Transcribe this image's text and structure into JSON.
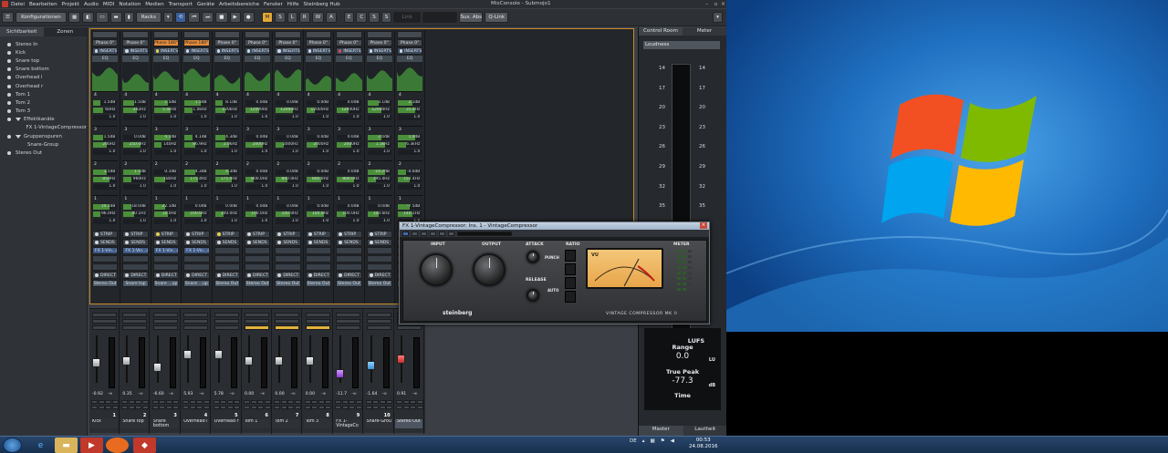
{
  "menubar": {
    "items": [
      "Datei",
      "Bearbeiten",
      "Projekt",
      "Audio",
      "MIDI",
      "Notation",
      "Medien",
      "Transport",
      "Geräte",
      "Arbeitsbereiche",
      "Fenster",
      "Hilfe",
      "Steinberg Hub"
    ],
    "title": "MixConsole - Submojo1"
  },
  "toolbar": {
    "config_label": "Konfigurationen",
    "racks_label": "Racks",
    "m": "M",
    "s": "S",
    "l": "L",
    "r": "R",
    "w": "W",
    "a": "A",
    "e": "E",
    "c": "C",
    "s2": "S",
    "s3": "S",
    "link": "Link",
    "sun_abs": "Sus. Abs",
    "qlink": "Q-Link"
  },
  "leftpanel": {
    "tab_visibility": "Sichtbarkeit",
    "tab_zones": "Zonen",
    "items": [
      {
        "label": "Stereo In",
        "indent": 0,
        "type": "dot"
      },
      {
        "label": "Kick",
        "indent": 0,
        "type": "dot"
      },
      {
        "label": "Snare top",
        "indent": 0,
        "type": "dot"
      },
      {
        "label": "Snare bottom",
        "indent": 0,
        "type": "dot"
      },
      {
        "label": "Overhead l",
        "indent": 0,
        "type": "dot"
      },
      {
        "label": "Overhead r",
        "indent": 0,
        "type": "dot"
      },
      {
        "label": "Tom 1",
        "indent": 0,
        "type": "dot"
      },
      {
        "label": "Tom 2",
        "indent": 0,
        "type": "dot"
      },
      {
        "label": "Tom 3",
        "indent": 0,
        "type": "dot"
      },
      {
        "label": "Effektkanäle",
        "indent": 0,
        "type": "group"
      },
      {
        "label": "FX 1-VintageCompressor",
        "indent": 1,
        "type": "none"
      },
      {
        "label": "Gruppenspuren",
        "indent": 0,
        "type": "group"
      },
      {
        "label": "Snare-Group",
        "indent": 1,
        "type": "none"
      },
      {
        "label": "Stereo Out",
        "indent": 0,
        "type": "dot"
      }
    ]
  },
  "channels": [
    {
      "phase": "Phase 0°",
      "phase_on": false,
      "ins_dot": "w",
      "eq": [
        [
          "1.5dB",
          "60Hz",
          "1.0"
        ],
        [
          "1.5dB",
          "200Hz",
          "1.0"
        ],
        [
          "1.5dB",
          "850Hz",
          "1.0"
        ],
        [
          "10.1dB",
          "96.0Hz",
          "1.0"
        ]
      ],
      "strip_dot": "w",
      "fx": "FX 1-Vin...or",
      "out": "Stereo Out",
      "fader": "-0.92",
      "num": "1",
      "name": "Kick",
      "cap": "white",
      "cap_pos": 0.55
    },
    {
      "phase": "Phase 0°",
      "phase_on": false,
      "ins_dot": "w",
      "eq": [
        [
          "1.5dB",
          "202Hz",
          "1.0"
        ],
        [
          "0.0dB",
          "250.0Hz",
          "1.0"
        ],
        [
          "1.1dB",
          "960Hz",
          "1.0"
        ],
        [
          "-18.0dB",
          "40.1Hz",
          "1.0"
        ]
      ],
      "strip_dot": "w",
      "fx": "FX 1-Vin...or",
      "out": "Snare top",
      "fader": "0.35",
      "num": "2",
      "name": "Snare top",
      "cap": "white",
      "cap_pos": 0.5
    },
    {
      "phase": "Phase 180°",
      "phase_on": true,
      "ins_dot": "y",
      "eq": [
        [
          "1.5dB",
          "5.4kHz",
          "1.0"
        ],
        [
          "4.1dB",
          "140Hz",
          "1.0"
        ],
        [
          "0.1dB",
          "180Hz",
          "1.0"
        ],
        [
          "22.1dB",
          "10.0Hz",
          "1.0"
        ]
      ],
      "strip_dot": "y",
      "fx": "FX 1-Vin...or",
      "out": "Snare ...up",
      "fader": "-6.60",
      "num": "3",
      "name": "Snare bottom",
      "cap": "white",
      "cap_pos": 0.65
    },
    {
      "phase": "Phase 180°",
      "phase_on": true,
      "ins_dot": "w",
      "eq": [
        [
          "1.5dB",
          "1.0kHz",
          "1.0"
        ],
        [
          "4.1dB",
          "86.9Hz",
          "1.0"
        ],
        [
          "4.3dB",
          "175.4Hz",
          "1.0"
        ],
        [
          "0.0dB",
          "100.0Hz",
          "1.0"
        ]
      ],
      "strip_dot": "w",
      "fx": "FX 1-Vin...or",
      "out": "Snare ...up",
      "fader": "5.93",
      "num": "4",
      "name": "Overhead l",
      "cap": "white",
      "cap_pos": 0.35
    },
    {
      "phase": "Phase 0°",
      "phase_on": false,
      "ins_dot": "w",
      "eq": [
        [
          "8.1dB",
          "120kHz",
          "1.0"
        ],
        [
          "4.3dB",
          "2.0kHz",
          "1.0"
        ],
        [
          "4.3dB",
          "175.4Hz",
          "1.0"
        ],
        [
          "0.0dB",
          "100.0Hz",
          "1.0"
        ]
      ],
      "strip_dot": "y",
      "fx": "",
      "out": "Stereo Out",
      "fader": "5.78",
      "num": "5",
      "name": "Overhead r",
      "cap": "white",
      "cap_pos": 0.36
    },
    {
      "phase": "Phase 0°",
      "phase_on": false,
      "ins_dot": "w",
      "eq": [
        [
          "0.0dB",
          "12000Hz",
          "1.0"
        ],
        [
          "0.0dB",
          "2000Hz",
          "1.0"
        ],
        [
          "0.0dB",
          "800.0Hz",
          "1.0"
        ],
        [
          "0.0dB",
          "100.0Hz",
          "1.0"
        ]
      ],
      "strip_dot": "w",
      "fx": "",
      "out": "Stereo Out",
      "fader": "0.00",
      "num": "6",
      "name": "Tom 1",
      "cap": "white",
      "cap_pos": 0.5
    },
    {
      "phase": "Phase 0°",
      "phase_on": false,
      "ins_dot": "w",
      "eq": [
        [
          "0.0dB",
          "12000Hz",
          "1.0"
        ],
        [
          "0.0dB",
          "2000Hz",
          "1.0"
        ],
        [
          "0.0dB",
          "800.0Hz",
          "1.0"
        ],
        [
          "0.0dB",
          "100.0Hz",
          "1.0"
        ]
      ],
      "strip_dot": "w",
      "fx": "",
      "out": "Stereo Out",
      "fader": "0.00",
      "num": "7",
      "name": "Tom 2",
      "cap": "white",
      "cap_pos": 0.5
    },
    {
      "phase": "Phase 0°",
      "phase_on": false,
      "ins_dot": "w",
      "eq": [
        [
          "0.0dB",
          "12000Hz",
          "1.0"
        ],
        [
          "0.0dB",
          "2000Hz",
          "1.0"
        ],
        [
          "0.0dB",
          "800.0Hz",
          "1.0"
        ],
        [
          "0.0dB",
          "100.0Hz",
          "1.0"
        ]
      ],
      "strip_dot": "w",
      "fx": "",
      "out": "Stereo Out",
      "fader": "0.00",
      "num": "8",
      "name": "Tom 3",
      "cap": "white",
      "cap_pos": 0.5
    },
    {
      "phase": "Phase 0°",
      "phase_on": false,
      "ins_dot": "r",
      "eq": [
        [
          "0.0dB",
          "12000Hz",
          "1.0"
        ],
        [
          "0.0dB",
          "2000Hz",
          "1.0"
        ],
        [
          "0.0dB",
          "800.0Hz",
          "1.0"
        ],
        [
          "0.0dB",
          "100.0Hz",
          "1.0"
        ]
      ],
      "strip_dot": "w",
      "fx": "",
      "out": "Stereo Out",
      "fader": "-11.7",
      "num": "9",
      "name": "FX 1-VintageCo",
      "cap": "purple",
      "cap_pos": 0.8
    },
    {
      "phase": "Phase 0°",
      "phase_on": false,
      "ins_dot": "w",
      "eq": [
        [
          "3.1dB",
          "12000Hz",
          "1.0"
        ],
        [
          "2.0dB",
          "1.5kHz",
          "1.0"
        ],
        [
          "-14.2dB",
          "195.4Hz",
          "1.0"
        ],
        [
          "0.0dB",
          "100.0Hz",
          "1.0"
        ]
      ],
      "strip_dot": "w",
      "fx": "",
      "out": "Stereo Out",
      "fader": "-1.64",
      "num": "10",
      "name": "Snare-Grou",
      "cap": "blue",
      "cap_pos": 0.6
    },
    {
      "phase": "Phase 0°",
      "phase_on": false,
      "ins_dot": "w",
      "eq": [
        [
          "2.1dB",
          "35.4Hz",
          "1.0"
        ],
        [
          "1.0dB",
          "6.3kHz",
          "1.0"
        ],
        [
          "-4.6dB",
          "152.4Hz",
          "1.0"
        ],
        [
          "-7.5dB",
          "140.1Hz",
          "1.0"
        ]
      ],
      "strip_dot": "w",
      "fx": "",
      "out": "Stereo Out",
      "fader": "0.91",
      "num": "",
      "name": "Stereo Out",
      "cap": "red",
      "cap_pos": 0.45
    }
  ],
  "rack_labels": {
    "inserts": "INSERTS",
    "eq": "EQ",
    "strip": "STRIP",
    "sends": "SENDS",
    "direct": "DIRECT"
  },
  "plugin": {
    "title": "FX 1-VintageCompressor: Ins. 1 - VintageCompressor",
    "input": "INPUT",
    "output": "OUTPUT",
    "attack": "ATTACK",
    "release": "RELEASE",
    "ratio": "RATIO",
    "meter": "METER",
    "punch": "PUNCH",
    "auto": "AUTO",
    "brand": "steinberg",
    "model": "VINTAGE COMPRESSOR MK II",
    "vu": "VU"
  },
  "rightrack": {
    "tab_control_room": "Control Room",
    "tab_meter": "Meter",
    "loudness": "Loudness",
    "scale_left": [
      "14",
      "17",
      "20",
      "23",
      "26",
      "29",
      "32",
      "35"
    ],
    "scale_right": [
      "14",
      "17",
      "20",
      "23",
      "26",
      "29",
      "32",
      "35"
    ],
    "lufs": "LUFS",
    "range_label": "Range",
    "range_value": "0.0",
    "range_unit": "LU",
    "truepeak_label": "True Peak",
    "truepeak_value": "-77.3",
    "truepeak_unit": "dB",
    "time_label": "Time",
    "tab_master": "Master",
    "tab_loudness": "Lautheit"
  },
  "taskbar": {
    "lang": "DE",
    "time": "00:53",
    "date": "24.08.2016"
  }
}
